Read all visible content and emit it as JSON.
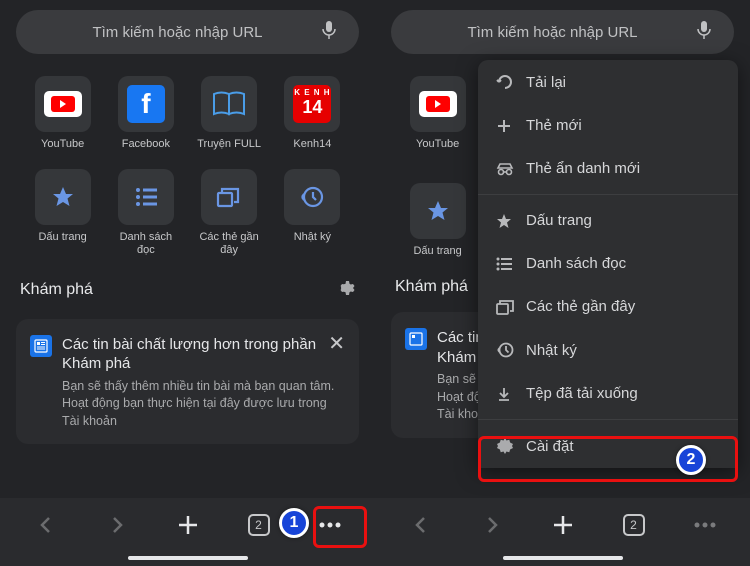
{
  "search_placeholder": "Tìm kiếm hoặc nhập URL",
  "shortcuts_row1": [
    {
      "label": "YouTube"
    },
    {
      "label": "Facebook"
    },
    {
      "label": "Truyện FULL"
    },
    {
      "label": "Kenh14"
    }
  ],
  "shortcuts_row2": [
    {
      "label": "Dấu trang"
    },
    {
      "label": "Danh sách đọc"
    },
    {
      "label": "Các thẻ gần đây"
    },
    {
      "label": "Nhật ký"
    }
  ],
  "discover_title": "Khám phá",
  "card": {
    "title": "Các tin bài chất lượng hơn trong phần Khám phá",
    "body": "Bạn sẽ thấy thêm nhiều tin bài mà bạn quan tâm. Hoạt động bạn thực hiện tại đây được lưu trong Tài khoản"
  },
  "tab_count": "2",
  "menu": {
    "reload": "Tải lại",
    "new_tab": "Thẻ mới",
    "incognito": "Thẻ ẩn danh mới",
    "bookmarks": "Dấu trang",
    "reading_list": "Danh sách đọc",
    "recent_tabs": "Các thẻ gần đây",
    "history": "Nhật ký",
    "downloads": "Tệp đã tải xuống",
    "settings": "Cài đặt"
  },
  "steps": {
    "one": "1",
    "two": "2"
  },
  "k14": {
    "top": "K E N H",
    "num": "14"
  }
}
